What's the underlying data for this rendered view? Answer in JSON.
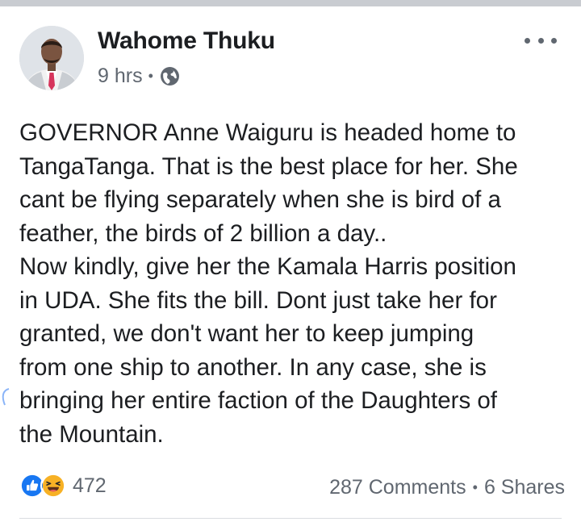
{
  "post": {
    "author": "Wahome Thuku",
    "time": "9 hrs",
    "separator": "•",
    "privacy_icon": "globe-icon",
    "more_icon": "more-options-icon",
    "body_lines": [
      "GOVERNOR Anne Waiguru is headed home to",
      "TangaTanga. That is the best place for her. She",
      "cant be flying separately when she is bird of a",
      "feather, the birds of 2 billion a day..",
      "Now kindly, give her the Kamala Harris position",
      "in UDA. She fits the bill. Dont just take her for",
      "granted, we don't want her to keep jumping",
      "from one ship to another. In any case, she is",
      "bringing her entire faction of the Daughters of",
      "the Mountain."
    ]
  },
  "engagement": {
    "reaction_icons": [
      "like-icon",
      "haha-icon"
    ],
    "reaction_count": "472",
    "comments": "287 Comments",
    "separator": "•",
    "shares": "6 Shares"
  },
  "colors": {
    "like_blue": "#1877f2",
    "haha_yellow": "#f7b125",
    "meta_gray": "#606770",
    "text": "#1c1e21"
  }
}
